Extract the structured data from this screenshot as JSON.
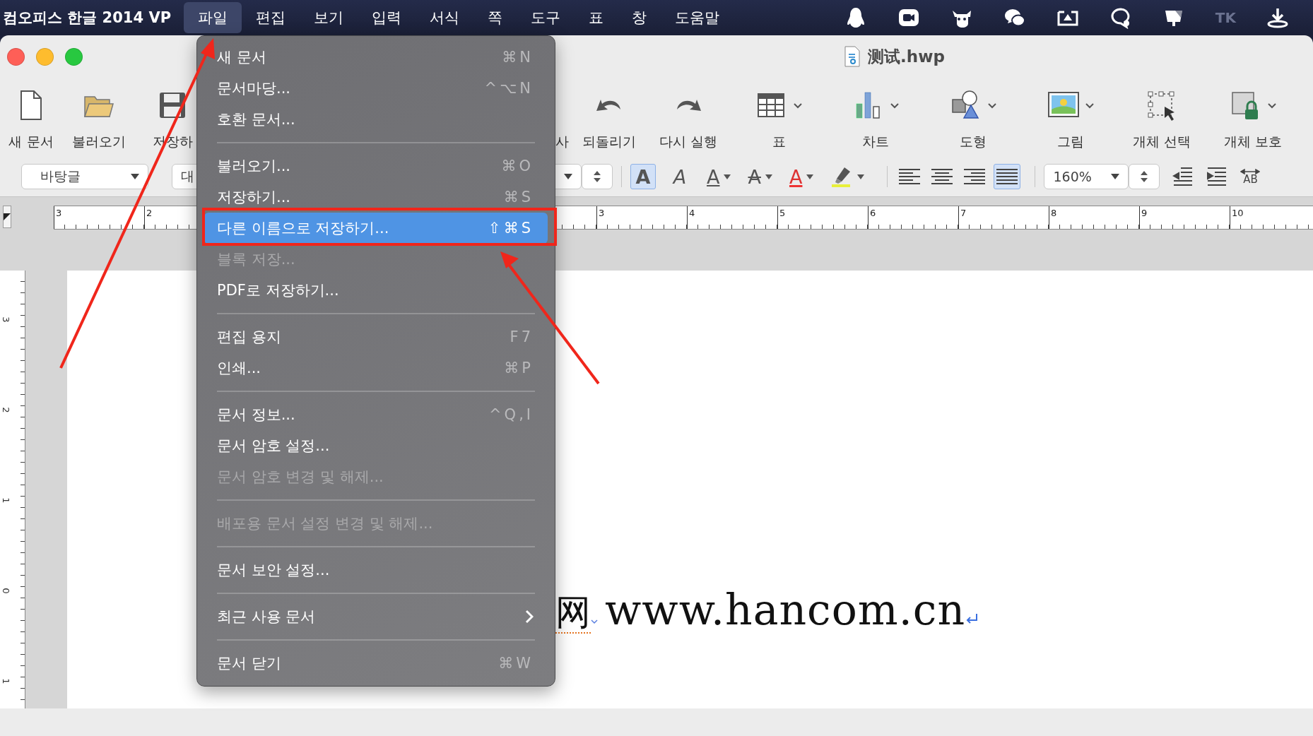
{
  "menu_bar": {
    "app_name": "컴오피스 한글 2014 VP",
    "items": [
      {
        "label": "파일",
        "selected": true
      },
      {
        "label": "편집",
        "selected": false
      },
      {
        "label": "보기",
        "selected": false
      },
      {
        "label": "입력",
        "selected": false
      },
      {
        "label": "서식",
        "selected": false
      },
      {
        "label": "쪽",
        "selected": false
      },
      {
        "label": "도구",
        "selected": false
      },
      {
        "label": "표",
        "selected": false
      },
      {
        "label": "창",
        "selected": false
      },
      {
        "label": "도움말",
        "selected": false
      }
    ],
    "status_text": "TK"
  },
  "window": {
    "title": "测试.hwp"
  },
  "toolbar": {
    "buttons": [
      {
        "kind": "new",
        "label": "새 문서",
        "dropdown": false
      },
      {
        "kind": "open",
        "label": "불러오기",
        "dropdown": false
      },
      {
        "kind": "save",
        "label": "저장하",
        "dropdown": false
      },
      {
        "kind": "covered",
        "label": "사",
        "dropdown": false
      },
      {
        "kind": "undo",
        "label": "되돌리기",
        "dropdown": false
      },
      {
        "kind": "redo",
        "label": "다시 실행",
        "dropdown": false
      },
      {
        "kind": "table",
        "label": "표",
        "dropdown": true
      },
      {
        "kind": "chart",
        "label": "차트",
        "dropdown": true
      },
      {
        "kind": "shape",
        "label": "도형",
        "dropdown": true
      },
      {
        "kind": "picture",
        "label": "그림",
        "dropdown": true
      },
      {
        "kind": "select",
        "label": "개체 선택",
        "dropdown": false
      },
      {
        "kind": "protect",
        "label": "개체 보호",
        "dropdown": true
      }
    ]
  },
  "format_bar": {
    "style": "바탕글",
    "font": "대",
    "zoom": "160%",
    "char_buttons": [
      {
        "kind": "bold",
        "glyph": "A",
        "selected": true,
        "dropdown": false
      },
      {
        "kind": "italic",
        "glyph": "A",
        "selected": false,
        "dropdown": false
      },
      {
        "kind": "underline",
        "glyph": "A",
        "selected": false,
        "dropdown": true
      },
      {
        "kind": "strike",
        "glyph": "A",
        "selected": false,
        "dropdown": true
      },
      {
        "kind": "color",
        "glyph": "A",
        "selected": false,
        "dropdown": true
      },
      {
        "kind": "highlight",
        "selected": false,
        "dropdown": true
      }
    ],
    "align_buttons": [
      {
        "kind": "left",
        "selected": false
      },
      {
        "kind": "center",
        "selected": false
      },
      {
        "kind": "right",
        "selected": false
      },
      {
        "kind": "justify",
        "selected": true
      }
    ],
    "paragraph_buttons": [
      {
        "kind": "outdent"
      },
      {
        "kind": "indent"
      },
      {
        "kind": "spacing",
        "glyph": "AB"
      }
    ]
  },
  "ruler": {
    "left_labels": [
      "3",
      "2"
    ],
    "right_labels": [
      "3",
      "4",
      "5",
      "6",
      "7",
      "8",
      "9",
      "10"
    ]
  },
  "vertical_ruler": {
    "labels": [
      "3",
      "2",
      "1",
      "0",
      "1"
    ]
  },
  "document": {
    "char": "网",
    "text": "www.hancom.cn"
  },
  "file_menu": {
    "sections": [
      [
        {
          "label": "새 문서",
          "shortcut": "⌘N",
          "disabled": false,
          "selected": false,
          "submenu": false
        },
        {
          "label": "문서마당...",
          "shortcut": "^⌥N",
          "disabled": false,
          "selected": false,
          "submenu": false
        },
        {
          "label": "호환 문서...",
          "disabled": false,
          "selected": false,
          "submenu": false
        }
      ],
      [
        {
          "label": "불러오기...",
          "shortcut": "⌘O",
          "disabled": false,
          "selected": false,
          "submenu": false
        },
        {
          "label": "저장하기...",
          "shortcut": "⌘S",
          "disabled": false,
          "selected": false,
          "submenu": false
        },
        {
          "label": "다른 이름으로 저장하기...",
          "shortcut": "⇧⌘S",
          "disabled": false,
          "selected": true,
          "submenu": false
        },
        {
          "label": "블록 저장...",
          "disabled": true,
          "selected": false,
          "submenu": false
        },
        {
          "label": "PDF로 저장하기...",
          "disabled": false,
          "selected": false,
          "submenu": false
        }
      ],
      [
        {
          "label": "편집 용지",
          "shortcut": "F7",
          "disabled": false,
          "selected": false,
          "submenu": false
        },
        {
          "label": "인쇄...",
          "shortcut": "⌘P",
          "disabled": false,
          "selected": false,
          "submenu": false
        }
      ],
      [
        {
          "label": "문서 정보...",
          "shortcut": "^Q,I",
          "disabled": false,
          "selected": false,
          "submenu": false
        },
        {
          "label": "문서 암호 설정...",
          "disabled": false,
          "selected": false,
          "submenu": false
        },
        {
          "label": "문서 암호 변경 및 해제...",
          "disabled": true,
          "selected": false,
          "submenu": false
        }
      ],
      [
        {
          "label": "배포용 문서 설정 변경 및 해제...",
          "disabled": true,
          "selected": false,
          "submenu": false
        }
      ],
      [
        {
          "label": "문서 보안 설정...",
          "disabled": false,
          "selected": false,
          "submenu": false
        }
      ],
      [
        {
          "label": "최근 사용 문서",
          "disabled": false,
          "selected": false,
          "submenu": true
        }
      ],
      [
        {
          "label": "문서 닫기",
          "shortcut": "⌘W",
          "disabled": false,
          "selected": false,
          "submenu": false
        }
      ]
    ]
  }
}
